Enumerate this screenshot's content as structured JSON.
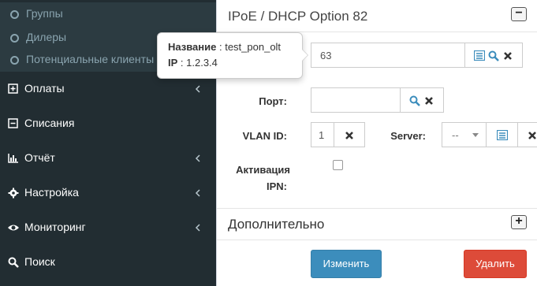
{
  "sidebar": {
    "sub_items": [
      {
        "label": "Группы"
      },
      {
        "label": "Дилеры"
      },
      {
        "label": "Потенциальные клиенты"
      }
    ],
    "nav_items": [
      {
        "label": "Оплаты",
        "icon": "plus-square-icon",
        "has_chevron": true
      },
      {
        "label": "Списания",
        "icon": "minus-square-icon",
        "has_chevron": false
      },
      {
        "label": "Отчёт",
        "icon": "bar-chart-icon",
        "has_chevron": true
      },
      {
        "label": "Настройка",
        "icon": "gear-icon",
        "has_chevron": true
      },
      {
        "label": "Мониторинг",
        "icon": "eye-icon",
        "has_chevron": true
      },
      {
        "label": "Поиск",
        "icon": "search-icon",
        "has_chevron": false
      }
    ]
  },
  "panel": {
    "title": "IPoE / DHCP Option 82",
    "collapse_symbol": "−",
    "nas_value": "63",
    "port_label": "Порт:",
    "port_value": "",
    "vlan_label": "VLAN ID:",
    "vlan_value": "1",
    "server_label": "Server:",
    "server_value": "--",
    "activation_label_line1": "Активация",
    "activation_label_line2": "IPN:",
    "additional_title": "Дополнительно",
    "expand_symbol": "+",
    "change_button": "Изменить",
    "delete_button": "Удалить"
  },
  "tooltip": {
    "name_label": "Название",
    "name_value": " : test_pon_olt",
    "ip_label": "IP",
    "ip_value": " : 1.2.3.4"
  },
  "colors": {
    "sidebar_bg": "#222d32",
    "submenu_bg": "#2c3b41",
    "primary": "#3c8dbc",
    "danger": "#dd4b39",
    "icon_blue": "#3c8dbc"
  }
}
